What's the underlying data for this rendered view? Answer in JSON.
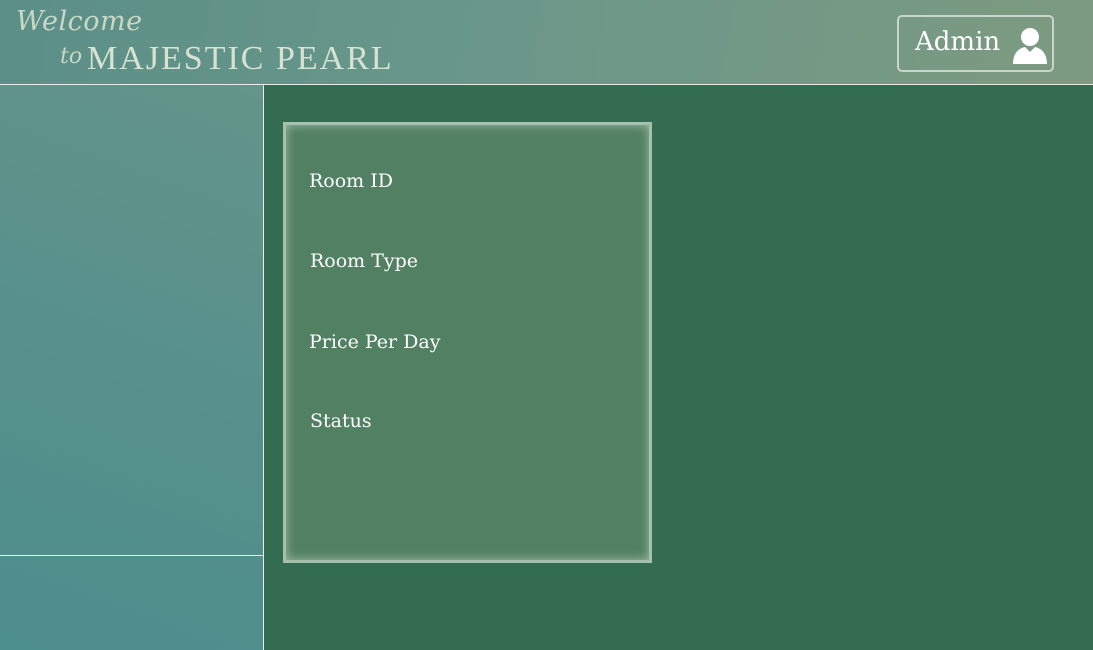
{
  "header": {
    "welcome": "Welcome",
    "to": "to",
    "brand_name": "MAJESTIC PEARL"
  },
  "user": {
    "label": "Admin",
    "icon": "user-icon"
  },
  "room_card": {
    "fields": [
      {
        "label": "Room ID"
      },
      {
        "label": "Room Type"
      },
      {
        "label": "Price Per Day"
      },
      {
        "label": "Status"
      }
    ]
  },
  "colors": {
    "background": "#336c50",
    "card": "#518062",
    "header_start": "#5b8f87",
    "header_end": "#7d9a80",
    "sidebar": "#56908c",
    "accent_text": "#c9d8c4"
  }
}
